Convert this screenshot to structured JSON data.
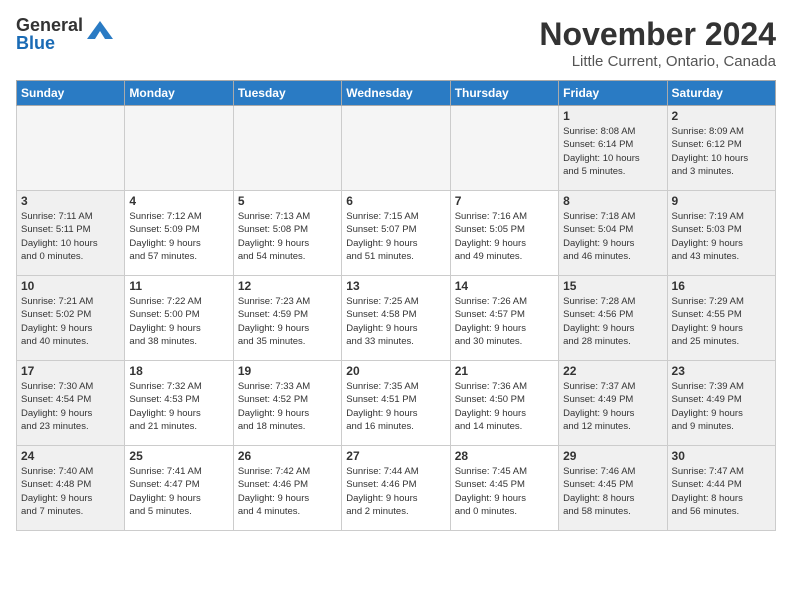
{
  "logo": {
    "general": "General",
    "blue": "Blue"
  },
  "title": "November 2024",
  "location": "Little Current, Ontario, Canada",
  "days_of_week": [
    "Sunday",
    "Monday",
    "Tuesday",
    "Wednesday",
    "Thursday",
    "Friday",
    "Saturday"
  ],
  "weeks": [
    [
      {
        "day": "",
        "info": "",
        "empty": true
      },
      {
        "day": "",
        "info": "",
        "empty": true
      },
      {
        "day": "",
        "info": "",
        "empty": true
      },
      {
        "day": "",
        "info": "",
        "empty": true
      },
      {
        "day": "",
        "info": "",
        "empty": true
      },
      {
        "day": "1",
        "info": "Sunrise: 8:08 AM\nSunset: 6:14 PM\nDaylight: 10 hours\nand 5 minutes.",
        "weekend": true
      },
      {
        "day": "2",
        "info": "Sunrise: 8:09 AM\nSunset: 6:12 PM\nDaylight: 10 hours\nand 3 minutes.",
        "weekend": true
      }
    ],
    [
      {
        "day": "3",
        "info": "Sunrise: 7:11 AM\nSunset: 5:11 PM\nDaylight: 10 hours\nand 0 minutes.",
        "weekend": true
      },
      {
        "day": "4",
        "info": "Sunrise: 7:12 AM\nSunset: 5:09 PM\nDaylight: 9 hours\nand 57 minutes."
      },
      {
        "day": "5",
        "info": "Sunrise: 7:13 AM\nSunset: 5:08 PM\nDaylight: 9 hours\nand 54 minutes."
      },
      {
        "day": "6",
        "info": "Sunrise: 7:15 AM\nSunset: 5:07 PM\nDaylight: 9 hours\nand 51 minutes."
      },
      {
        "day": "7",
        "info": "Sunrise: 7:16 AM\nSunset: 5:05 PM\nDaylight: 9 hours\nand 49 minutes."
      },
      {
        "day": "8",
        "info": "Sunrise: 7:18 AM\nSunset: 5:04 PM\nDaylight: 9 hours\nand 46 minutes.",
        "weekend": true
      },
      {
        "day": "9",
        "info": "Sunrise: 7:19 AM\nSunset: 5:03 PM\nDaylight: 9 hours\nand 43 minutes.",
        "weekend": true
      }
    ],
    [
      {
        "day": "10",
        "info": "Sunrise: 7:21 AM\nSunset: 5:02 PM\nDaylight: 9 hours\nand 40 minutes.",
        "weekend": true
      },
      {
        "day": "11",
        "info": "Sunrise: 7:22 AM\nSunset: 5:00 PM\nDaylight: 9 hours\nand 38 minutes."
      },
      {
        "day": "12",
        "info": "Sunrise: 7:23 AM\nSunset: 4:59 PM\nDaylight: 9 hours\nand 35 minutes."
      },
      {
        "day": "13",
        "info": "Sunrise: 7:25 AM\nSunset: 4:58 PM\nDaylight: 9 hours\nand 33 minutes."
      },
      {
        "day": "14",
        "info": "Sunrise: 7:26 AM\nSunset: 4:57 PM\nDaylight: 9 hours\nand 30 minutes."
      },
      {
        "day": "15",
        "info": "Sunrise: 7:28 AM\nSunset: 4:56 PM\nDaylight: 9 hours\nand 28 minutes.",
        "weekend": true
      },
      {
        "day": "16",
        "info": "Sunrise: 7:29 AM\nSunset: 4:55 PM\nDaylight: 9 hours\nand 25 minutes.",
        "weekend": true
      }
    ],
    [
      {
        "day": "17",
        "info": "Sunrise: 7:30 AM\nSunset: 4:54 PM\nDaylight: 9 hours\nand 23 minutes.",
        "weekend": true
      },
      {
        "day": "18",
        "info": "Sunrise: 7:32 AM\nSunset: 4:53 PM\nDaylight: 9 hours\nand 21 minutes."
      },
      {
        "day": "19",
        "info": "Sunrise: 7:33 AM\nSunset: 4:52 PM\nDaylight: 9 hours\nand 18 minutes."
      },
      {
        "day": "20",
        "info": "Sunrise: 7:35 AM\nSunset: 4:51 PM\nDaylight: 9 hours\nand 16 minutes."
      },
      {
        "day": "21",
        "info": "Sunrise: 7:36 AM\nSunset: 4:50 PM\nDaylight: 9 hours\nand 14 minutes."
      },
      {
        "day": "22",
        "info": "Sunrise: 7:37 AM\nSunset: 4:49 PM\nDaylight: 9 hours\nand 12 minutes.",
        "weekend": true
      },
      {
        "day": "23",
        "info": "Sunrise: 7:39 AM\nSunset: 4:49 PM\nDaylight: 9 hours\nand 9 minutes.",
        "weekend": true
      }
    ],
    [
      {
        "day": "24",
        "info": "Sunrise: 7:40 AM\nSunset: 4:48 PM\nDaylight: 9 hours\nand 7 minutes.",
        "weekend": true
      },
      {
        "day": "25",
        "info": "Sunrise: 7:41 AM\nSunset: 4:47 PM\nDaylight: 9 hours\nand 5 minutes."
      },
      {
        "day": "26",
        "info": "Sunrise: 7:42 AM\nSunset: 4:46 PM\nDaylight: 9 hours\nand 4 minutes."
      },
      {
        "day": "27",
        "info": "Sunrise: 7:44 AM\nSunset: 4:46 PM\nDaylight: 9 hours\nand 2 minutes."
      },
      {
        "day": "28",
        "info": "Sunrise: 7:45 AM\nSunset: 4:45 PM\nDaylight: 9 hours\nand 0 minutes."
      },
      {
        "day": "29",
        "info": "Sunrise: 7:46 AM\nSunset: 4:45 PM\nDaylight: 8 hours\nand 58 minutes.",
        "weekend": true
      },
      {
        "day": "30",
        "info": "Sunrise: 7:47 AM\nSunset: 4:44 PM\nDaylight: 8 hours\nand 56 minutes.",
        "weekend": true
      }
    ]
  ]
}
